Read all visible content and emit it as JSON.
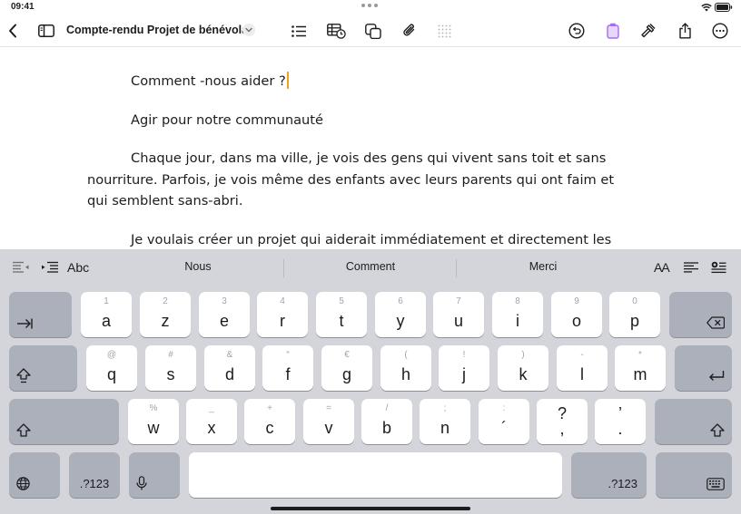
{
  "status": {
    "time": "09:41"
  },
  "toolbar": {
    "title": "Compte-rendu Projet de bénévolat"
  },
  "document": {
    "paragraphs": [
      "Comment  -nous aider ?",
      "Agir pour notre communauté",
      "Chaque jour, dans ma ville, je vois des gens qui vivent sans toit et sans",
      "nourriture. Parfois, je vois même des enfants avec leurs parents qui ont faim et",
      "qui semblent sans-abri.",
      "Je voulais créer un projet qui aiderait immédiatement et directement les"
    ]
  },
  "keyboard": {
    "abc_label": "Abc",
    "suggestions": [
      "Nous",
      "Comment",
      "Merci"
    ],
    "font_size_label": "AA",
    "row1": [
      {
        "main": "a",
        "sub": "1"
      },
      {
        "main": "z",
        "sub": "2"
      },
      {
        "main": "e",
        "sub": "3"
      },
      {
        "main": "r",
        "sub": "4"
      },
      {
        "main": "t",
        "sub": "5"
      },
      {
        "main": "y",
        "sub": "6"
      },
      {
        "main": "u",
        "sub": "7"
      },
      {
        "main": "i",
        "sub": "8"
      },
      {
        "main": "o",
        "sub": "9"
      },
      {
        "main": "p",
        "sub": "0"
      }
    ],
    "row2": [
      {
        "main": "q",
        "sub": "@"
      },
      {
        "main": "s",
        "sub": "#"
      },
      {
        "main": "d",
        "sub": "&"
      },
      {
        "main": "f",
        "sub": "“"
      },
      {
        "main": "g",
        "sub": "€"
      },
      {
        "main": "h",
        "sub": "("
      },
      {
        "main": "j",
        "sub": "!"
      },
      {
        "main": "k",
        "sub": ")"
      },
      {
        "main": "l",
        "sub": "-"
      },
      {
        "main": "m",
        "sub": "*"
      }
    ],
    "row3": [
      {
        "main": "w",
        "sub": "%"
      },
      {
        "main": "x",
        "sub": "_"
      },
      {
        "main": "c",
        "sub": "+"
      },
      {
        "main": "v",
        "sub": "="
      },
      {
        "main": "b",
        "sub": "/"
      },
      {
        "main": "n",
        "sub": ";"
      },
      {
        "main": "´",
        "sub": ":"
      },
      {
        "main": "?\n,",
        "sub": ""
      },
      {
        "main": "’\n.",
        "sub": ""
      }
    ],
    "numbers_label": ".?123"
  }
}
